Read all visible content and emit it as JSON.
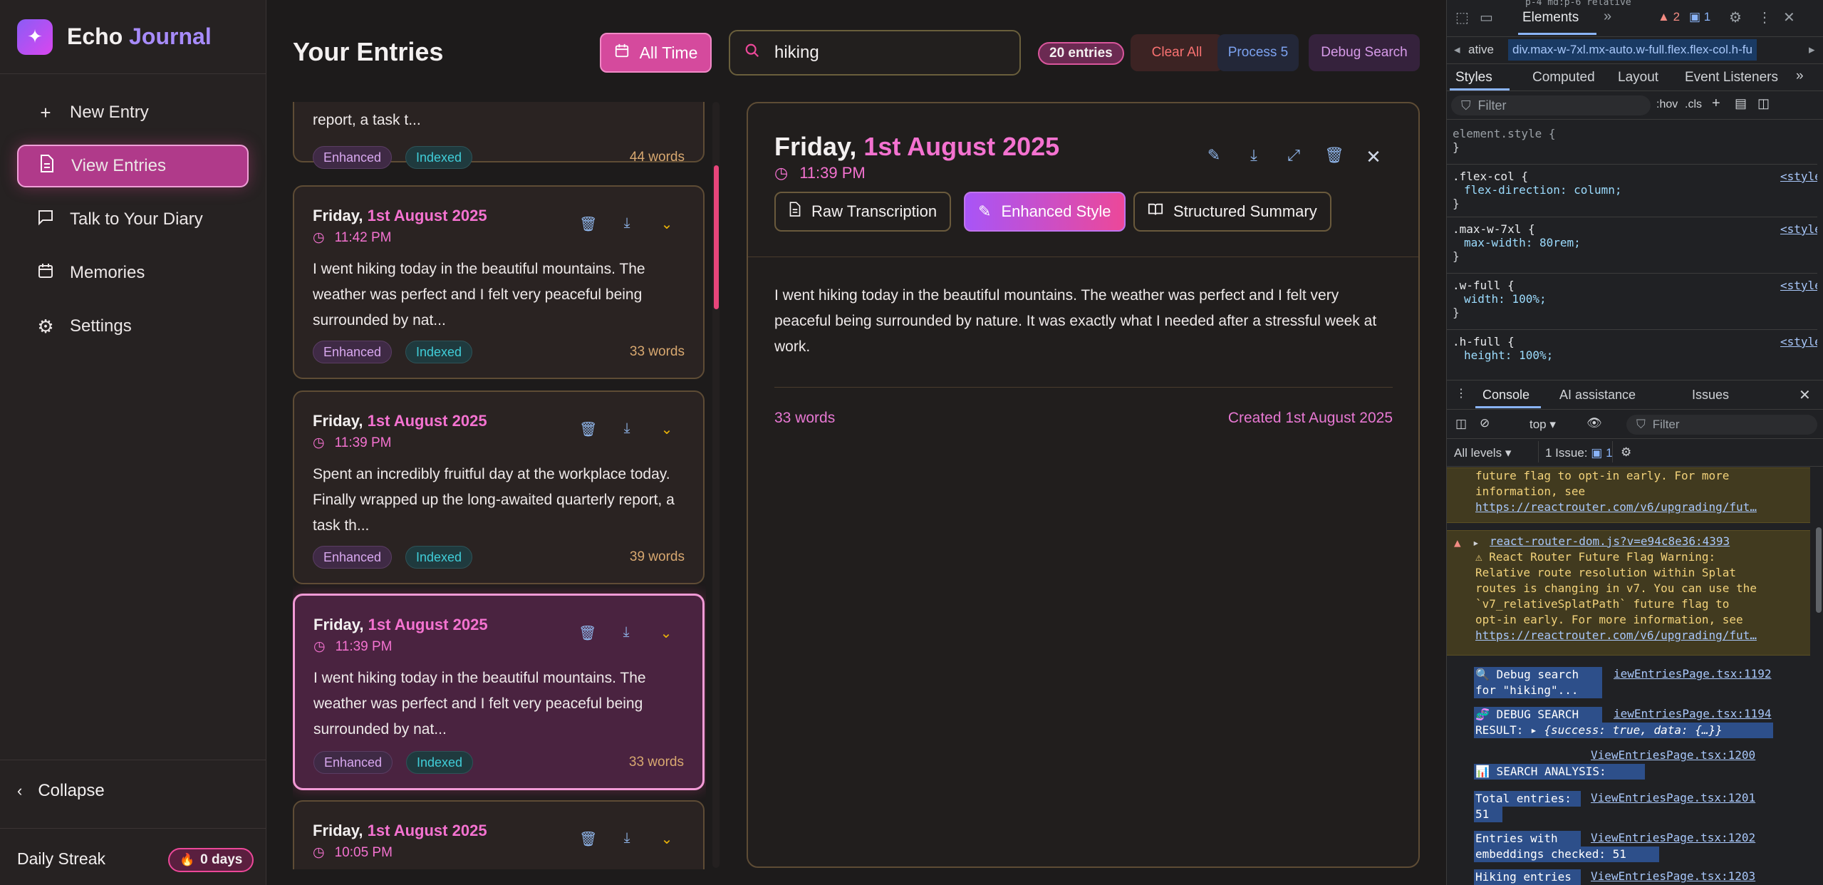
{
  "app": {
    "brand_first": "Echo",
    "brand_second": "Journal",
    "colors": {
      "accent_pink": "#ec4899",
      "accent_purple": "#a855f7",
      "bg": "#1d1b1b"
    }
  },
  "sidebar": {
    "items": [
      {
        "label": "New Entry",
        "icon": "plus-icon"
      },
      {
        "label": "View Entries",
        "icon": "document-icon"
      },
      {
        "label": "Talk to Your Diary",
        "icon": "chat-icon"
      },
      {
        "label": "Memories",
        "icon": "calendar-icon"
      },
      {
        "label": "Settings",
        "icon": "gear-icon"
      }
    ],
    "collapse_label": "Collapse",
    "streak_label": "Daily Streak",
    "streak_value": "0 days"
  },
  "header": {
    "title": "Your Entries",
    "filter_label": "All Time",
    "search_value": "hiking",
    "count_badge": "20 entries",
    "clear_label": "Clear All",
    "process_label": "Process 5",
    "debug_label": "Debug Search"
  },
  "entries": [
    {
      "text": "report, a task t...",
      "tag1": "Enhanced",
      "tag2": "Indexed",
      "words": "44 words"
    },
    {
      "weekday": "Friday,",
      "date": "1st August 2025",
      "time": "11:42 PM",
      "text": "I went hiking today in the beautiful mountains. The weather was perfect and I felt very peaceful being surrounded by nat...",
      "tag1": "Enhanced",
      "tag2": "Indexed",
      "words": "33 words"
    },
    {
      "weekday": "Friday,",
      "date": "1st August 2025",
      "time": "11:39 PM",
      "text": "Spent an incredibly fruitful day at the workplace today. Finally wrapped up the long-awaited quarterly report, a task th...",
      "tag1": "Enhanced",
      "tag2": "Indexed",
      "words": "39 words"
    },
    {
      "weekday": "Friday,",
      "date": "1st August 2025",
      "time": "11:39 PM",
      "text": "I went hiking today in the beautiful mountains. The weather was perfect and I felt very peaceful being surrounded by nat...",
      "tag1": "Enhanced",
      "tag2": "Indexed",
      "words": "33 words"
    },
    {
      "weekday": "Friday,",
      "date": "1st August 2025",
      "time": "10:05 PM"
    }
  ],
  "detail": {
    "weekday": "Friday,",
    "date": "1st August 2025",
    "time": "11:39 PM",
    "tab_raw": "Raw Transcription",
    "tab_enhanced": "Enhanced Style",
    "tab_summary": "Structured Summary",
    "body": "I went hiking today in the beautiful mountains. The weather was perfect and I felt very peaceful being surrounded by nature. It was exactly what I needed after a stressful week at work.",
    "words": "33 words",
    "created": "Created 1st August 2025"
  },
  "devtools": {
    "tab_elements": "Elements",
    "warn_count": "2",
    "info_count": "1",
    "breadcrumb_left": "ative",
    "breadcrumb_main": "div.max-w-7xl.mx-auto.w-full.flex.flex-col.h-fu",
    "top_overflow": "p-4 md:p-6 relative",
    "subtabs": [
      "Styles",
      "Computed",
      "Layout",
      "Event Listeners"
    ],
    "filter_placeholder": "Filter",
    "hov": ":hov",
    "cls": ".cls",
    "css": [
      {
        "sel": "element.style {",
        "props": [],
        "src": ""
      },
      {
        "sel": ".flex-col {",
        "props": [
          "flex-direction: column;"
        ],
        "src": "<style>"
      },
      {
        "sel": ".max-w-7xl {",
        "props": [
          "max-width: 80rem;"
        ],
        "src": "<style>"
      },
      {
        "sel": ".w-full {",
        "props": [
          "width: 100%;"
        ],
        "src": "<style>"
      },
      {
        "sel": ".h-full {",
        "props": [
          "height: 100%;"
        ],
        "src": "<style>"
      }
    ],
    "console_tabs": [
      "Console",
      "AI assistance",
      "Issues"
    ],
    "context": "top",
    "console_filter": "Filter",
    "levels": "All levels",
    "issues_label": "1 Issue:",
    "issues_count": "1",
    "logs": {
      "w1_l1": "future flag to opt-in early. For more",
      "w1_l2": "information, see",
      "w1_link": "https://reactrouter.com/v6/upgrading/fut…",
      "w2_src": "react-router-dom.js?v=e94c8e36:4393",
      "w2_l1": "⚠ React Router Future Flag Warning:",
      "w2_l2": "Relative route resolution within Splat",
      "w2_l3": "routes is changing in v7. You can use the",
      "w2_l4": "`v7_relativeSplatPath` future flag to",
      "w2_l5": "opt-in early. For more information, see",
      "w2_link": "https://reactrouter.com/v6/upgrading/fut…",
      "s1_a": "🔍 Debug search",
      "s1_src": "iewEntriesPage.tsx:1192",
      "s1_b": "for \"hiking\"...",
      "s2_a": "🧬 DEBUG SEARCH",
      "s2_src": "iewEntriesPage.tsx:1194",
      "s2_b": "RESULT:",
      "s2_obj": "{success: true, data: {…}}",
      "s3_src": "ViewEntriesPage.tsx:1200",
      "s3_b": "📊 SEARCH ANALYSIS:",
      "s4_a": "Total entries:",
      "s4_src": "ViewEntriesPage.tsx:1201",
      "s4_b": "51",
      "s5_a": "Entries with",
      "s5_src": "ViewEntriesPage.tsx:1202",
      "s5_b": "embeddings checked: 51",
      "s6_a": "Hiking entries",
      "s6_src": "ViewEntriesPage.tsx:1203"
    }
  }
}
